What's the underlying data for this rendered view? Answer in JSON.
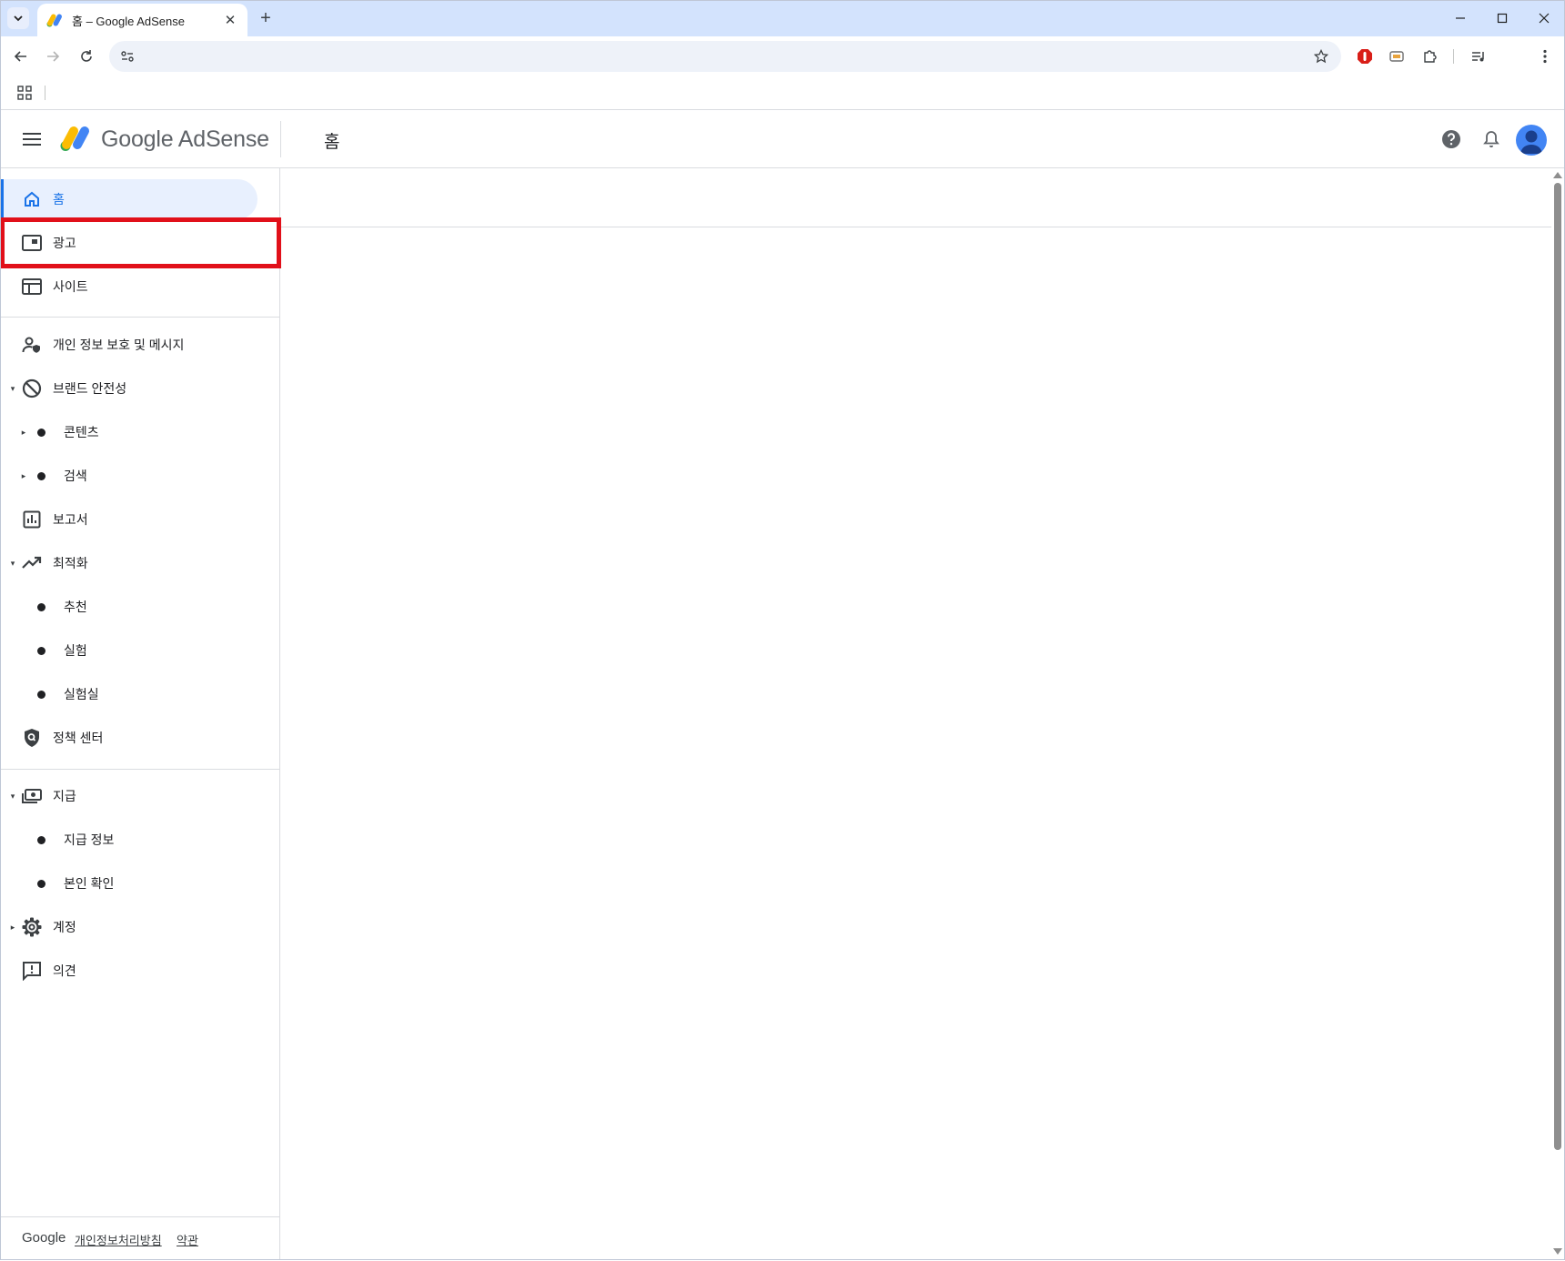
{
  "browser": {
    "tab_title": "홈 – Google AdSense",
    "tab_close": "✕",
    "new_tab": "+"
  },
  "header": {
    "brand": "Google AdSense",
    "page_title": "홈"
  },
  "sidebar": {
    "items": [
      {
        "label": "홈"
      },
      {
        "label": "광고"
      },
      {
        "label": "사이트"
      },
      {
        "label": "개인 정보 보호 및 메시지"
      },
      {
        "label": "브랜드 안전성"
      },
      {
        "label": "콘텐츠"
      },
      {
        "label": "검색"
      },
      {
        "label": "보고서"
      },
      {
        "label": "최적화"
      },
      {
        "label": "추천"
      },
      {
        "label": "실험"
      },
      {
        "label": "실험실"
      },
      {
        "label": "정책 센터"
      },
      {
        "label": "지급"
      },
      {
        "label": "지급 정보"
      },
      {
        "label": "본인 확인"
      },
      {
        "label": "계정"
      },
      {
        "label": "의견"
      }
    ]
  },
  "footer": {
    "google": "Google",
    "privacy": "개인정보처리방침",
    "terms": "약관"
  },
  "colors": {
    "accent": "#1a73e8",
    "highlight_box": "#e1101a",
    "active_bg": "#e8f0fe",
    "tabstrip": "#d3e3fd"
  }
}
